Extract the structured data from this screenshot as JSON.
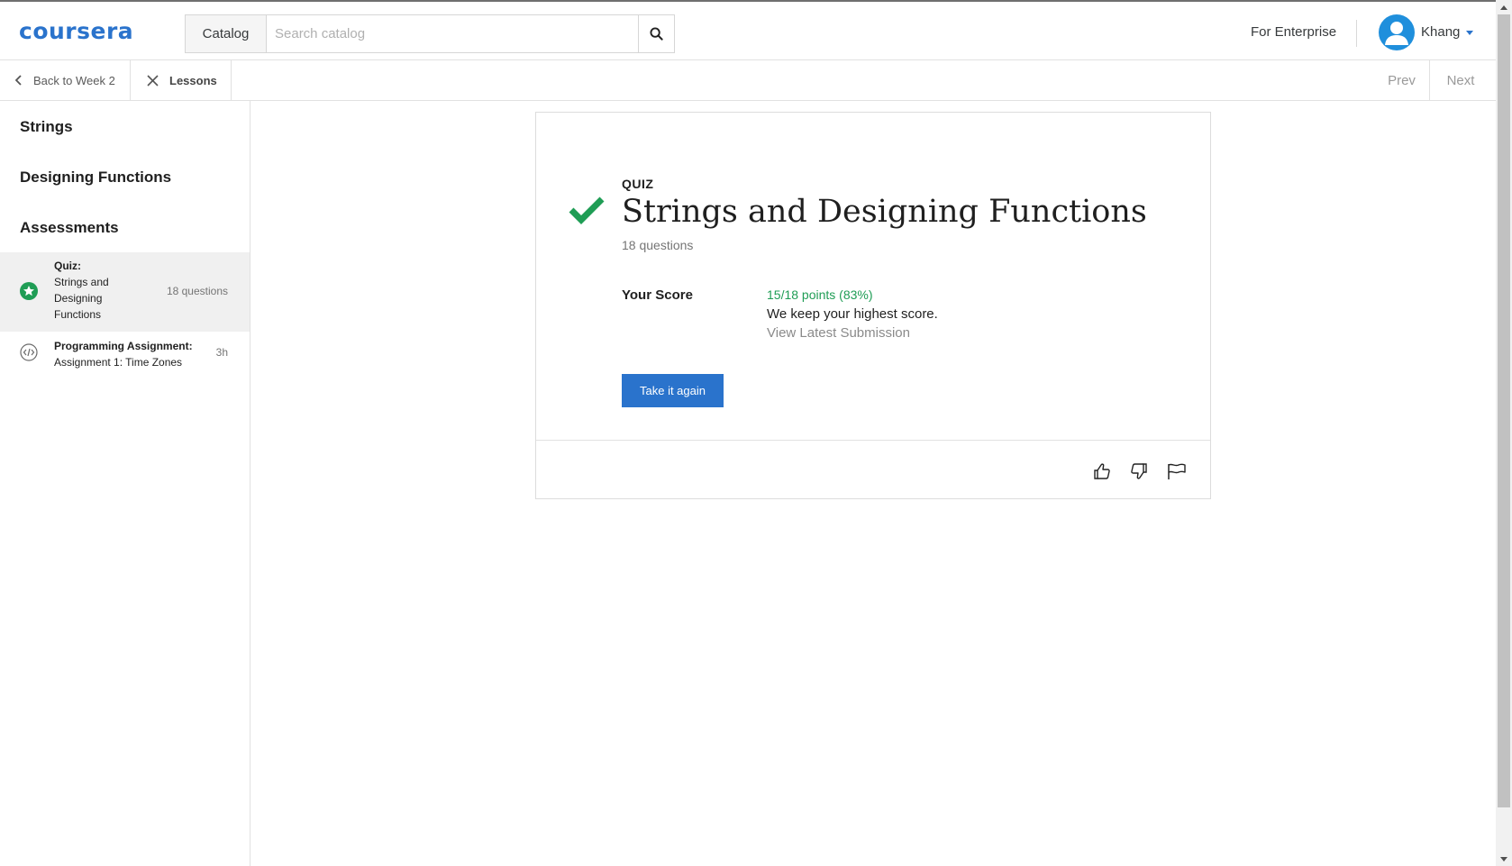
{
  "header": {
    "logo_text": "coursera",
    "catalog_label": "Catalog",
    "search_placeholder": "Search catalog",
    "search_icon": "search-icon",
    "enterprise_label": "For Enterprise",
    "user_name": "Khang",
    "avatar_icon": "user-avatar-icon",
    "accent_color": "#2a73cc"
  },
  "subnav": {
    "back_label": "Back to Week 2",
    "lessons_label": "Lessons",
    "prev_label": "Prev",
    "next_label": "Next"
  },
  "sidebar": {
    "sections": [
      "Strings",
      "Designing Functions",
      "Assessments"
    ],
    "items": [
      {
        "type_label": "Quiz:",
        "title": "Strings and Designing Functions",
        "meta": "18 questions",
        "icon": "completed-star-icon",
        "active": true
      },
      {
        "type_label": "Programming Assignment:",
        "title": "Assignment 1: Time Zones",
        "meta": "3h",
        "icon": "code-icon",
        "active": false
      }
    ]
  },
  "quiz": {
    "label": "QUIZ",
    "title": "Strings and Designing Functions",
    "question_count": "18 questions",
    "score_label": "Your Score",
    "score_value": "15/18 points (83%)",
    "score_note": "We keep your highest score.",
    "view_submission": "View Latest Submission",
    "retake_label": "Take it again",
    "success_color": "#1f9d55",
    "status_icon": "checkmark-icon"
  },
  "feedback": {
    "like_icon": "thumbs-up-icon",
    "dislike_icon": "thumbs-down-icon",
    "flag_icon": "flag-icon"
  }
}
